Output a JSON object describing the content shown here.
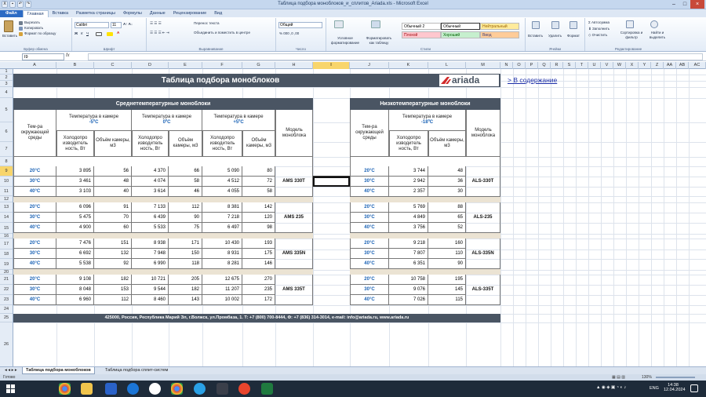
{
  "window": {
    "title": "Таблица подбора моноблоков_и_сплитов_Ariada.xls - Microsoft Excel"
  },
  "ribbon": {
    "tabs": [
      "Файл",
      "Главная",
      "Вставка",
      "Разметка страницы",
      "Формулы",
      "Данные",
      "Рецензирование",
      "Вид"
    ],
    "active_tab": "Главная",
    "clipboard": {
      "paste": "Вставить",
      "cut": "Вырезать",
      "copy": "Копировать",
      "format_painter": "Формат по образцу",
      "label": "Буфер обмена"
    },
    "font": {
      "name": "Calibri",
      "size": "11",
      "label": "Шрифт"
    },
    "alignment": {
      "wrap": "Перенос текста",
      "merge": "Объединить и поместить в центре",
      "label": "Выравнивание"
    },
    "number": {
      "format": "Общий",
      "label": "Число"
    },
    "styles": {
      "conditional": "Условное форматирование",
      "as_table": "Форматировать как таблицу",
      "normal2": "Обычный 2",
      "normal": "Обычный",
      "neutral": "Нейтральный",
      "bad": "Плохой",
      "good": "Хороший",
      "input": "Ввод",
      "label": "Стили"
    },
    "cells": {
      "insert": "Вставить",
      "delete": "Удалить",
      "format": "Формат",
      "label": "Ячейки"
    },
    "editing": {
      "autosum": "Автосумма",
      "fill": "Заполнить",
      "clear": "Очистить",
      "sort": "Сортировка и фильтр",
      "find": "Найти и выделить",
      "label": "Редактирование"
    }
  },
  "formula_bar": {
    "name_box": "I9",
    "fx": "fx",
    "value": ""
  },
  "columns": [
    "A",
    "B",
    "C",
    "D",
    "E",
    "F",
    "G",
    "H",
    "I",
    "J",
    "K",
    "L",
    "M",
    "N",
    "O",
    "P",
    "Q",
    "R",
    "S",
    "T",
    "U",
    "V",
    "W",
    "X",
    "Y",
    "Z",
    "AA",
    "AB",
    "AC"
  ],
  "rows": [
    "1",
    "2",
    "3",
    "4",
    "5",
    "6",
    "7",
    "8",
    "9",
    "10",
    "11",
    "12",
    "13",
    "14",
    "15",
    "16",
    "17",
    "18",
    "19",
    "20",
    "21",
    "22",
    "23",
    "24",
    "25",
    "26"
  ],
  "sheet": {
    "title": "Таблица подбора моноблоков",
    "logo_text": "ariada",
    "link": "> В содержание",
    "medium": {
      "title": "Среднетемпературные моноблоки",
      "env_header": "Тем-ра окружающей среды",
      "model_header": "Модель моноблока",
      "chamber_label": "Температура в камере",
      "temps": [
        "-5ºC",
        "0ºC",
        "+5ºC"
      ],
      "sub_cap": "Холодопро изводитель ность, Вт",
      "sub_vol": "Объём камеры, м3",
      "groups": [
        {
          "model": "AMS 330T",
          "rows": [
            {
              "env": "20°C",
              "v": [
                "3 895",
                "56",
                "4 370",
                "66",
                "5 090",
                "80"
              ]
            },
            {
              "env": "30°C",
              "v": [
                "3 461",
                "48",
                "4 074",
                "58",
                "4 512",
                "72"
              ]
            },
            {
              "env": "40°C",
              "v": [
                "3 103",
                "40",
                "3 614",
                "46",
                "4 055",
                "58"
              ]
            }
          ]
        },
        {
          "model": "AMS 235",
          "rows": [
            {
              "env": "20°C",
              "v": [
                "6 096",
                "91",
                "7 133",
                "112",
                "8 381",
                "142"
              ]
            },
            {
              "env": "30°C",
              "v": [
                "5 475",
                "70",
                "6 439",
                "90",
                "7 218",
                "120"
              ]
            },
            {
              "env": "40°C",
              "v": [
                "4 900",
                "60",
                "5 533",
                "75",
                "6 497",
                "98"
              ]
            }
          ]
        },
        {
          "model": "AMS 335N",
          "rows": [
            {
              "env": "20°C",
              "v": [
                "7 476",
                "151",
                "8 938",
                "171",
                "10 430",
                "193"
              ]
            },
            {
              "env": "30°C",
              "v": [
                "6 692",
                "132",
                "7 948",
                "150",
                "8 931",
                "175"
              ]
            },
            {
              "env": "40°C",
              "v": [
                "5 538",
                "92",
                "6 990",
                "118",
                "8 281",
                "146"
              ]
            }
          ]
        },
        {
          "model": "AMS 335T",
          "rows": [
            {
              "env": "20°C",
              "v": [
                "9 108",
                "182",
                "10 721",
                "205",
                "12 675",
                "270"
              ]
            },
            {
              "env": "30°C",
              "v": [
                "8 048",
                "153",
                "9 544",
                "182",
                "11 207",
                "235"
              ]
            },
            {
              "env": "40°C",
              "v": [
                "6 960",
                "112",
                "8 460",
                "143",
                "10 002",
                "172"
              ]
            }
          ]
        }
      ]
    },
    "low": {
      "title": "Низкотемпературные моноблоки",
      "env_header": "Тем-ра окружающей среды",
      "model_header": "Модель моноблока",
      "chamber_label": "Температура в камере",
      "temp": "-18ºC",
      "sub_cap": "Холодопро изводитель ность, Вт",
      "sub_vol": "Объём камеры, м3",
      "groups": [
        {
          "model": "ALS-330T",
          "rows": [
            {
              "env": "20°C",
              "v": [
                "3 744",
                "48"
              ]
            },
            {
              "env": "30°C",
              "v": [
                "2 942",
                "36"
              ]
            },
            {
              "env": "40°C",
              "v": [
                "2 357",
                "30"
              ]
            }
          ]
        },
        {
          "model": "ALS-235",
          "rows": [
            {
              "env": "20°C",
              "v": [
                "5 769",
                "88"
              ]
            },
            {
              "env": "30°C",
              "v": [
                "4 849",
                "65"
              ]
            },
            {
              "env": "40°C",
              "v": [
                "3 756",
                "52"
              ]
            }
          ]
        },
        {
          "model": "ALS-335N",
          "rows": [
            {
              "env": "20°C",
              "v": [
                "9 218",
                "160"
              ]
            },
            {
              "env": "30°C",
              "v": [
                "7 807",
                "110"
              ]
            },
            {
              "env": "40°C",
              "v": [
                "6 351",
                "90"
              ]
            }
          ]
        },
        {
          "model": "ALS-335T",
          "rows": [
            {
              "env": "20°C",
              "v": [
                "10 758",
                "195"
              ]
            },
            {
              "env": "30°C",
              "v": [
                "9 076",
                "145"
              ]
            },
            {
              "env": "40°C",
              "v": [
                "7 026",
                "115"
              ]
            }
          ]
        }
      ]
    },
    "footer": "425000, Россия, Республика Марий Эл, г.Волжск, ул.Промбаза, 1. Т: +7 (800) 700-8444, Ф: +7 (836) 314-3014, e-mail: info@ariada.ru, www.ariada.ru"
  },
  "sheet_tabs": [
    "Таблица подбора моноблоков",
    "Таблица подбора сплит-систем"
  ],
  "status": {
    "ready": "Готово",
    "zoom": "130%"
  },
  "taskbar": {
    "lang": "ENG",
    "time": "14:38",
    "date": "12.04.2024"
  },
  "colors": {
    "dark_band": "#4a5563",
    "temp_blue": "#1a62b5",
    "ariada_red": "#d22a2a",
    "separator": "#ebe3d3",
    "selection": "#f8d56b"
  }
}
